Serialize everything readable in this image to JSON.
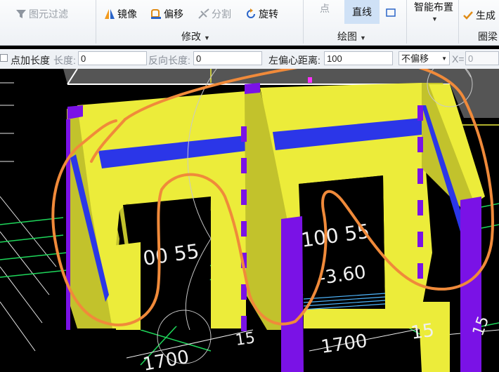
{
  "ribbon": {
    "filter_label": "图元过滤",
    "mirror_label": "镜像",
    "offset_label": "偏移",
    "split_label": "分割",
    "rotate_label": "旋转",
    "modify_group": "修改",
    "point_label": "点",
    "line_label": "直线",
    "draw_group": "绘图",
    "smart_layout_label": "智能布置",
    "generate_label": "生成",
    "ring_beam_group": "圈梁"
  },
  "options_bar": {
    "point_length_label": "点加长度",
    "length_label": "长度:",
    "length_value": "0",
    "reverse_length_label": "反向长度:",
    "reverse_length_value": "0",
    "offset_distance_label": "左偏心距离:",
    "offset_distance_value": "100",
    "offset_mode_value": "不偏移",
    "x_label": "X=",
    "x_value": "0"
  },
  "drawing": {
    "dim_texts": [
      "00 55",
      "100 55",
      "-3.60",
      "1700",
      "1700",
      "15",
      "15",
      "15"
    ],
    "colors": {
      "wall_yellow": "#ecec3a",
      "wall_side": "#c2c22c",
      "beam_blue": "#2b36e8",
      "column_purple": "#7a12e6",
      "grid_green": "#1ed65a",
      "annotation_orange": "#f08a3a"
    }
  }
}
